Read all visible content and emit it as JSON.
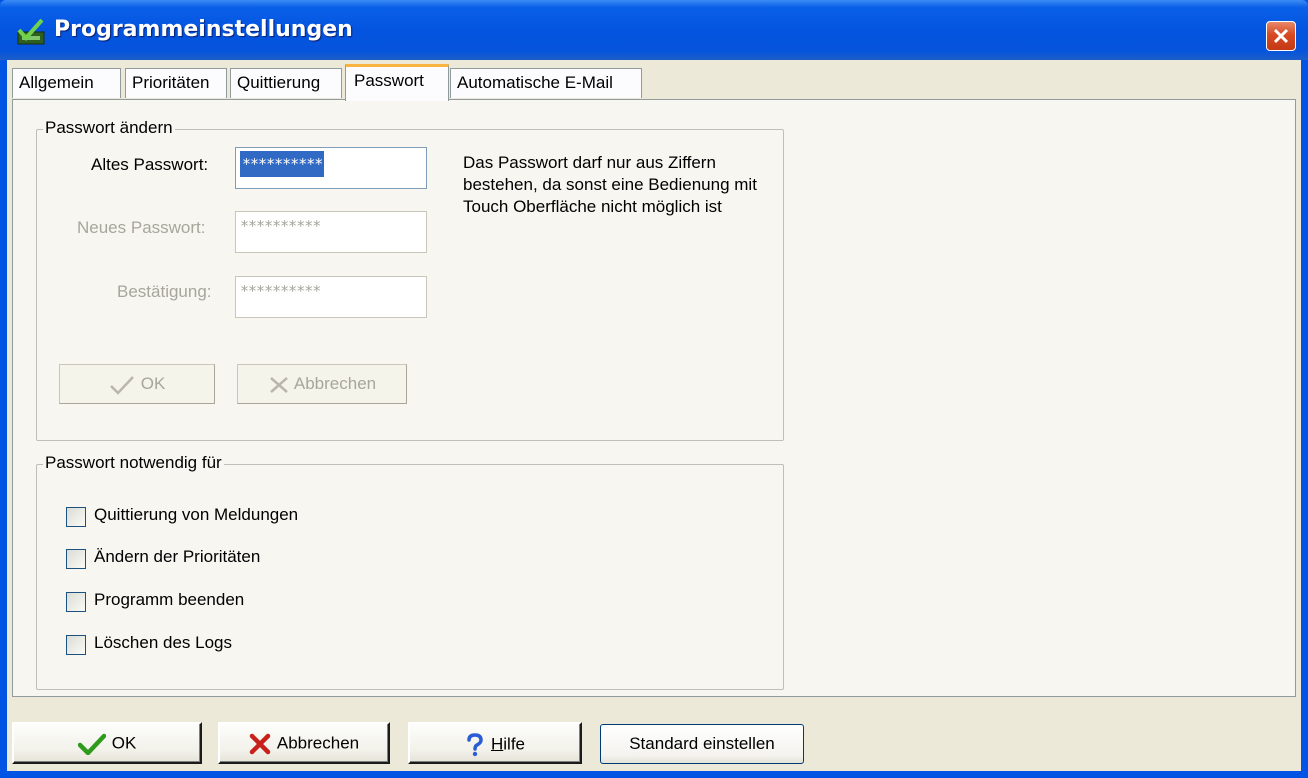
{
  "window": {
    "title": "Programmeinstellungen"
  },
  "tabs": [
    {
      "label": "Allgemein",
      "active": false
    },
    {
      "label": "Prioritäten",
      "active": false
    },
    {
      "label": "Quittierung",
      "active": false
    },
    {
      "label": "Passwort",
      "active": true
    },
    {
      "label": "Automatische E-Mail",
      "active": false
    }
  ],
  "password_change": {
    "legend": "Passwort ändern",
    "old_label": "Altes Passwort:",
    "old_value": "**********",
    "new_label": "Neues Passwort:",
    "new_value": "**********",
    "confirm_label": "Bestätigung:",
    "confirm_value": "**********",
    "hint": "Das Passwort darf nur aus Ziffern bestehen, da sonst eine Bedienung mit Touch Oberfläche nicht möglich ist",
    "ok_label": "OK",
    "cancel_label": "Abbrechen"
  },
  "password_required": {
    "legend": "Passwort notwendig für",
    "options": [
      {
        "label": "Quittierung von Meldungen",
        "checked": false
      },
      {
        "label": "Ändern der Prioritäten",
        "checked": false
      },
      {
        "label": "Programm beenden",
        "checked": false
      },
      {
        "label": "Löschen des Logs",
        "checked": false
      }
    ]
  },
  "buttons": {
    "ok": "OK",
    "cancel": "Abbrechen",
    "help_prefix": "H",
    "help_rest": "ilfe",
    "defaults": "Standard einstellen"
  },
  "colors": {
    "titlebar": "#0454e0",
    "selection": "#316ac5",
    "ok_check": "#2f9a1c",
    "cancel_x": "#c8201a",
    "help_q": "#2a5cd6"
  }
}
